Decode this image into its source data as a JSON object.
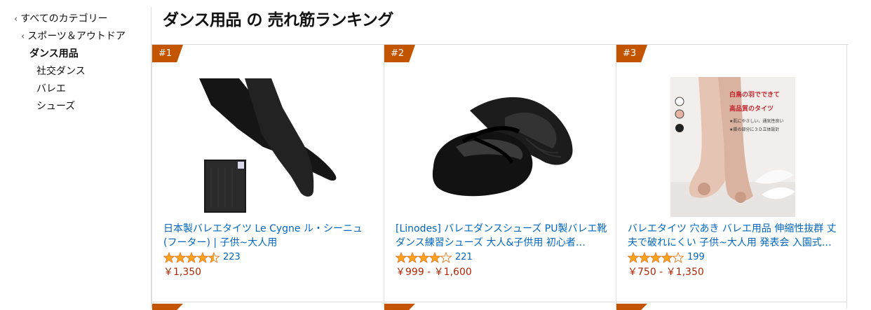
{
  "sidebar": {
    "all_categories": "すべてのカテゴリー",
    "parent": "スポーツ＆アウトドア",
    "current": "ダンス用品",
    "children": [
      "社交ダンス",
      "バレエ",
      "シューズ"
    ]
  },
  "page_title": "ダンス用品 の 売れ筋ランキング",
  "products": [
    {
      "rank": "#1",
      "title": "日本製バレエタイツ Le Cygne ル・シーニュ (フーター) | 子供~大人用",
      "rating": 4.5,
      "reviews": "223",
      "price": "￥1,350"
    },
    {
      "rank": "#2",
      "title": "[Linodes] バレエダンスシューズ PU製バレエ靴 ダンス練習シューズ 大人&子供用 初心者…",
      "rating": 4.0,
      "reviews": "221",
      "price": "￥999 - ￥1,600"
    },
    {
      "rank": "#3",
      "title": "バレエタイツ 穴あき バレエ用品 伸縮性抜群 丈夫で破れにくい 子供~大人用 発表会 入園式…",
      "rating": 4.0,
      "reviews": "199",
      "price": "￥750 - ￥1,350",
      "image_text": {
        "headline1": "白鳥の羽でできて",
        "headline2": "高品質のタイツ",
        "bullet1": "★肌にやさしい、通気性良い",
        "bullet2": "★脚の部分に３Ｄ立体設計"
      }
    }
  ],
  "colors": {
    "badge": "#c45500",
    "link": "#0066c0",
    "price": "#b12704",
    "star": "#ffa41c"
  }
}
